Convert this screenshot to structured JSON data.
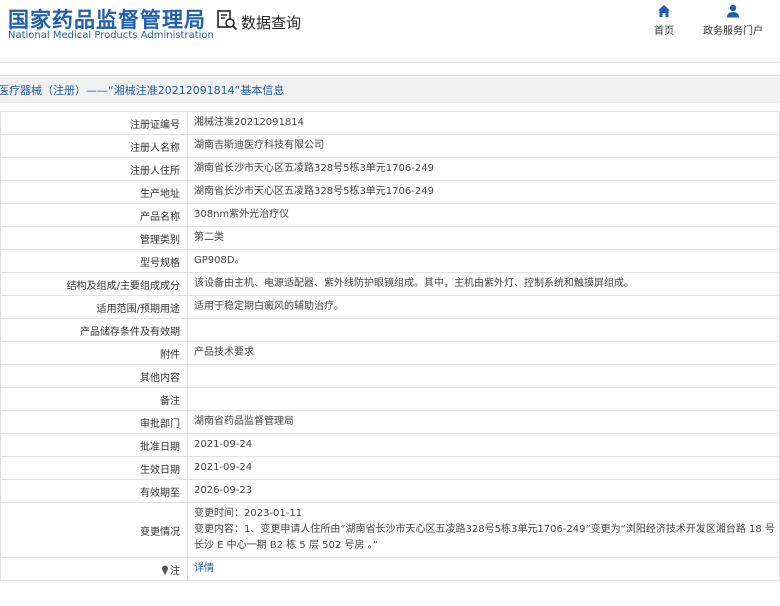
{
  "header": {
    "logo_cn": "国家药品监督管理局",
    "logo_en": "National Medical Products Administration",
    "query_label": "数据查询",
    "nav": [
      {
        "label": "首页",
        "icon": "home-icon"
      },
      {
        "label": "政务服务门户",
        "icon": "user-icon"
      }
    ]
  },
  "banner": {
    "text": "医疗器械（注册）——“湘械注准20212091814”基本信息"
  },
  "colors": {
    "brand_blue": "#1f5fae",
    "banner_bg": "#f1f1f1",
    "border": "#e2e2e2"
  },
  "rows": [
    {
      "label": "注册证编号",
      "value": "湘械注准20212091814"
    },
    {
      "label": "注册人名称",
      "value": "湖南吉斯迪医疗科技有限公司"
    },
    {
      "label": "注册人住所",
      "value": "湖南省长沙市天心区五凌路328号5栋3单元1706-249"
    },
    {
      "label": "生产地址",
      "value": "湖南省长沙市天心区五凌路328号5栋3单元1706-249"
    },
    {
      "label": "产品名称",
      "value": "308nm紫外光治疗仪"
    },
    {
      "label": "管理类别",
      "value": "第二类"
    },
    {
      "label": "型号规格",
      "value": "GP908D。"
    },
    {
      "label": "结构及组成/主要组成成分",
      "value": "该设备由主机、电源适配器、紫外线防护眼镜组成。其中，主机由紫外灯、控制系统和触摸屏组成。"
    },
    {
      "label": "适用范围/预期用途",
      "value": "适用于稳定期白癜风的辅助治疗。"
    },
    {
      "label": "产品储存条件及有效期",
      "value": ""
    },
    {
      "label": "附件",
      "value": "产品技术要求"
    },
    {
      "label": "其他内容",
      "value": ""
    },
    {
      "label": "备注",
      "value": ""
    },
    {
      "label": "审批部门",
      "value": "湖南省药品监督管理局"
    },
    {
      "label": "批准日期",
      "value": "2021-09-24"
    },
    {
      "label": "生效日期",
      "value": "2021-09-24"
    },
    {
      "label": "有效期至",
      "value": "2026-09-23"
    }
  ],
  "change": {
    "label": "变更情况",
    "time": "变更时间：2023-01-11",
    "content": "变更内容：1、变更申请人住所由“湖南省长沙市天心区五凌路328号5栋3单元1706-249”变更为“浏阳经济技术开发区湘台路 18 号长沙 E 中心一期 B2 栋 5 层 502 号房 。”"
  },
  "notice": {
    "label": "注",
    "link": "详情"
  }
}
